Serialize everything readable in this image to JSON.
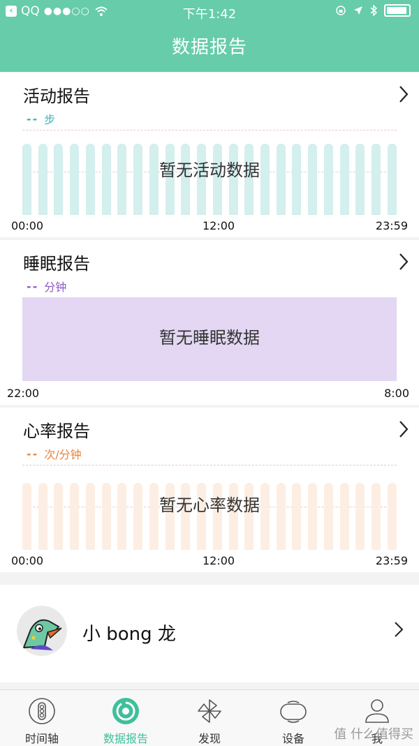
{
  "status_bar": {
    "back_app": "QQ",
    "time": "下午1:42"
  },
  "nav": {
    "title": "数据报告"
  },
  "activity": {
    "title": "活动报告",
    "legend": "步",
    "empty": "暂无活动数据",
    "axis": [
      "00:00",
      "12:00",
      "23:59"
    ],
    "color": "#3ab3b3",
    "bar_color": "#d3efee",
    "bar_count": 24
  },
  "sleep": {
    "title": "睡眠报告",
    "legend": "分钟",
    "empty": "暂无睡眠数据",
    "axis": [
      "22:00",
      "8:00"
    ],
    "color": "#8e57c8",
    "fill_color": "#e3d7f3"
  },
  "heart": {
    "title": "心率报告",
    "legend": "次/分钟",
    "empty": "暂无心率数据",
    "axis": [
      "00:00",
      "12:00",
      "23:59"
    ],
    "color": "#e8843c",
    "bar_color": "#fdeee3",
    "bar_count": 24
  },
  "profile": {
    "name": "小 bong 龙"
  },
  "tabs": [
    {
      "label": "时间轴",
      "icon": "timeline-icon",
      "active": false
    },
    {
      "label": "数据报告",
      "icon": "data-report-icon",
      "active": true
    },
    {
      "label": "发现",
      "icon": "pinwheel-icon",
      "active": false
    },
    {
      "label": "设备",
      "icon": "device-band-icon",
      "active": false
    },
    {
      "label": "我",
      "icon": "person-icon",
      "active": false
    }
  ],
  "watermark": "值 什么值得买"
}
